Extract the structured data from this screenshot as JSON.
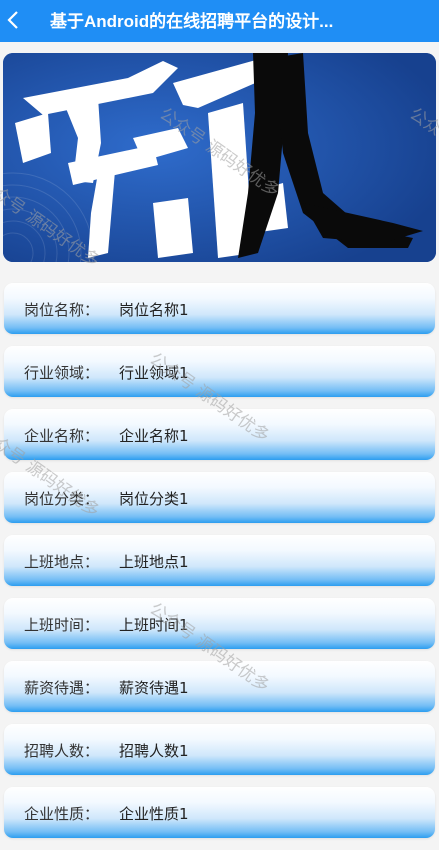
{
  "header": {
    "title": "基于Android的在线招聘平台的设计..."
  },
  "banner": {
    "image": "calligraphy-brush-art"
  },
  "fields": [
    {
      "label": "岗位名称：",
      "value": "岗位名称1"
    },
    {
      "label": "行业领域：",
      "value": "行业领域1"
    },
    {
      "label": "企业名称：",
      "value": "企业名称1"
    },
    {
      "label": "岗位分类：",
      "value": "岗位分类1"
    },
    {
      "label": "上班地点：",
      "value": "上班地点1"
    },
    {
      "label": "上班时间：",
      "value": "上班时间1"
    },
    {
      "label": "薪资待遇：",
      "value": "薪资待遇1"
    },
    {
      "label": "招聘人数：",
      "value": "招聘人数1"
    },
    {
      "label": "企业性质：",
      "value": "企业性质1"
    }
  ],
  "watermarks": [
    "公众号 源码好优多",
    "公众号 源码好优多",
    "公众号 源码好优多",
    "公众号 源码好优多",
    "公众号 源码好优多",
    "公众号 源码好优多"
  ],
  "colors": {
    "header": "#1f8ef5",
    "banner": "#2459b3",
    "row_gradient_bottom": "#2c9ef0"
  }
}
